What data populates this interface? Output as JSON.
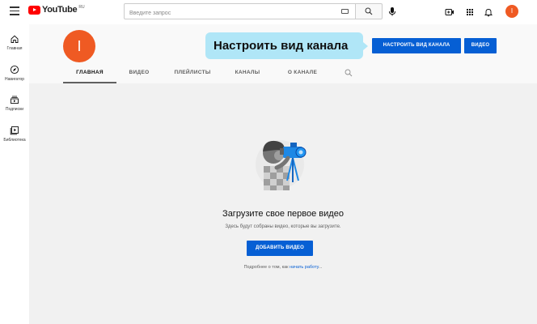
{
  "header": {
    "logo_text": "YouTube",
    "logo_country": "RU",
    "search_placeholder": "Введите запрос",
    "avatar_letter": "I"
  },
  "sidebar": {
    "items": [
      {
        "label": "Главная",
        "icon": "home-icon"
      },
      {
        "label": "Навигатор",
        "icon": "compass-icon"
      },
      {
        "label": "Подписки",
        "icon": "subscriptions-icon"
      },
      {
        "label": "Библиотека",
        "icon": "library-icon"
      }
    ]
  },
  "channel": {
    "avatar_letter": "I",
    "tooltip_text": "Настроить вид канала",
    "customize_button": "НАСТРОИТЬ ВИД КАНАЛА",
    "video_button": "ВИДЕО",
    "tabs": [
      "ГЛАВНАЯ",
      "ВИДЕО",
      "ПЛЕЙЛИСТЫ",
      "КАНАЛЫ",
      "О КАНАЛЕ"
    ],
    "active_tab": "ГЛАВНАЯ"
  },
  "empty_state": {
    "title": "Загрузите свое первое видео",
    "subtitle": "Здесь будут собраны видео, которые вы загрузите.",
    "add_button": "ДОБАВИТЬ ВИДЕО",
    "learn_prefix": "Подробнее о том, как ",
    "learn_link": "начать работу",
    "learn_suffix": "..."
  },
  "colors": {
    "accent_blue": "#065fd4",
    "avatar_orange": "#ef5a23",
    "tooltip_bg": "#b0e6f7",
    "logo_red": "#ff0000"
  }
}
